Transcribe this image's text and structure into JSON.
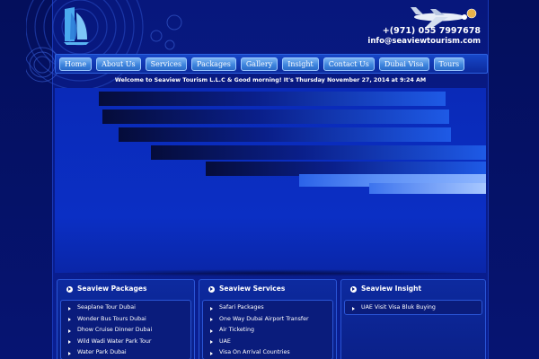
{
  "header": {
    "phone": "+(971) 055 7997678",
    "email": "info@seaviewtourism.com"
  },
  "nav": {
    "items": [
      "Home",
      "About Us",
      "Services",
      "Packages",
      "Gallery",
      "Insight",
      "Contact Us",
      "Dubai Visa",
      "Tours"
    ]
  },
  "welcome": "Welcome to Seaview Tourism L.L.C & Good morning! It's Thursday November 27, 2014 at 9:24 AM",
  "panels": [
    {
      "title": "Seaview Packages",
      "items": [
        "Seaplane Tour Dubai",
        "Wonder Bus Tours Dubai",
        "Dhow Cruise Dinner Dubai",
        "Wild Wadi Water Park Tour",
        "Water Park Dubai"
      ]
    },
    {
      "title": "Seaview Services",
      "items": [
        "Safari Packages",
        "One Way Dubai Airport Transfer",
        "Air Ticketing",
        "UAE",
        "Visa On Arrival Countries"
      ]
    },
    {
      "title": "Seaview Insight",
      "items": [
        "UAE Visit Visa Bluk Buying"
      ]
    }
  ],
  "icons": {
    "logo": "sail-logo-icon",
    "plane": "airplane-icon",
    "panel_bullet": "circle-arrow-icon",
    "list_bullet": "triangle-arrow-icon"
  },
  "colors": {
    "background": "#07136e",
    "nav_button": "#3f86de",
    "panel": "#0a1f86"
  }
}
